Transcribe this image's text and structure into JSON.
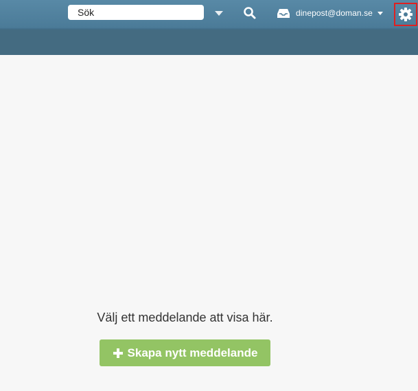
{
  "header": {
    "search": {
      "placeholder": "Sök"
    },
    "account": {
      "email": "dinepost@doman.se"
    },
    "icons": {
      "dropdown": "chevron-down-icon",
      "search": "search-icon",
      "inbox": "inbox-icon",
      "account_caret": "caret-down-icon",
      "settings": "gear-icon"
    },
    "settings_highlight_color": "#e02020"
  },
  "main": {
    "empty_text": "Välj ett meddelande att visa här.",
    "compose_label": "Skapa nytt meddelande",
    "compose_icon": "plus-icon",
    "compose_color": "#93c464"
  },
  "colors": {
    "header": "#4b7b98",
    "background": "#f7f7f7"
  }
}
